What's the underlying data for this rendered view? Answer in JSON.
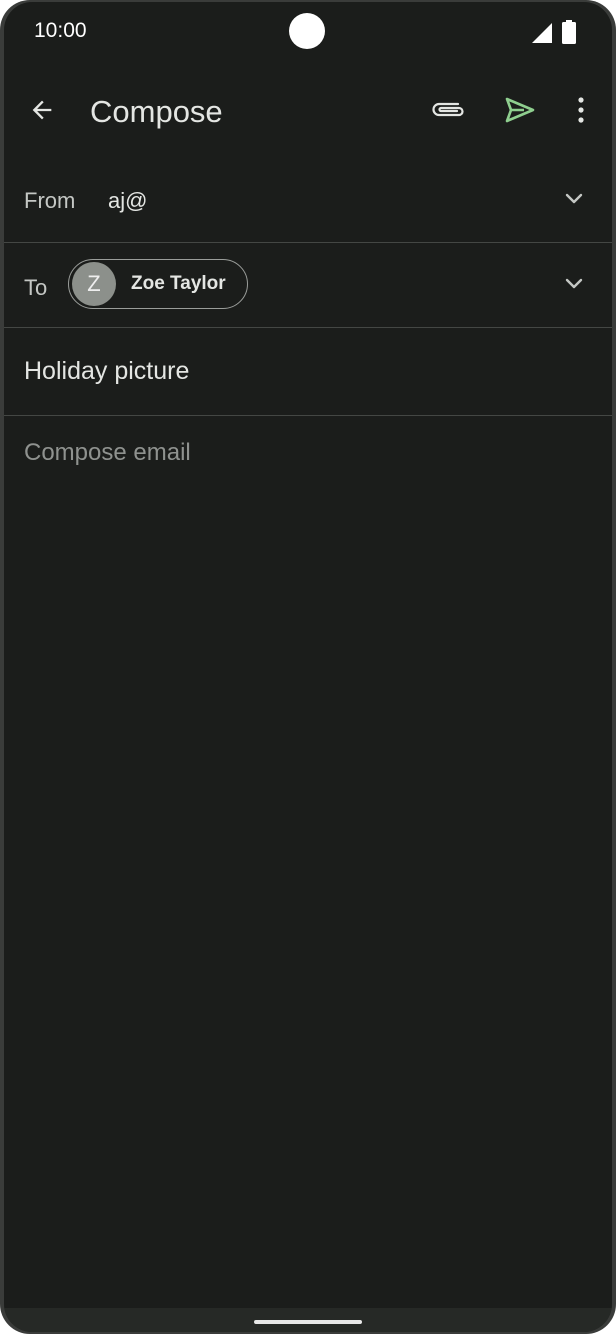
{
  "status_bar": {
    "time": "10:00",
    "signal_icon": "cellular-signal-icon",
    "battery_icon": "battery-icon"
  },
  "app_bar": {
    "title": "Compose",
    "back_icon": "arrow-back-icon",
    "attach_icon": "paperclip-icon",
    "send_icon": "send-icon",
    "more_icon": "more-vert-icon"
  },
  "from": {
    "label": "From",
    "value": "aj@"
  },
  "to": {
    "label": "To",
    "recipients": [
      {
        "initial": "Z",
        "name": "Zoe Taylor"
      }
    ]
  },
  "subject": {
    "value": "Holiday picture"
  },
  "body": {
    "placeholder": "Compose email"
  },
  "colors": {
    "background": "#1b1d1b",
    "send_accent": "#8fcf8f",
    "text_primary": "#e4e6e3",
    "text_secondary": "#c4c7c4",
    "placeholder": "#8f928f"
  }
}
